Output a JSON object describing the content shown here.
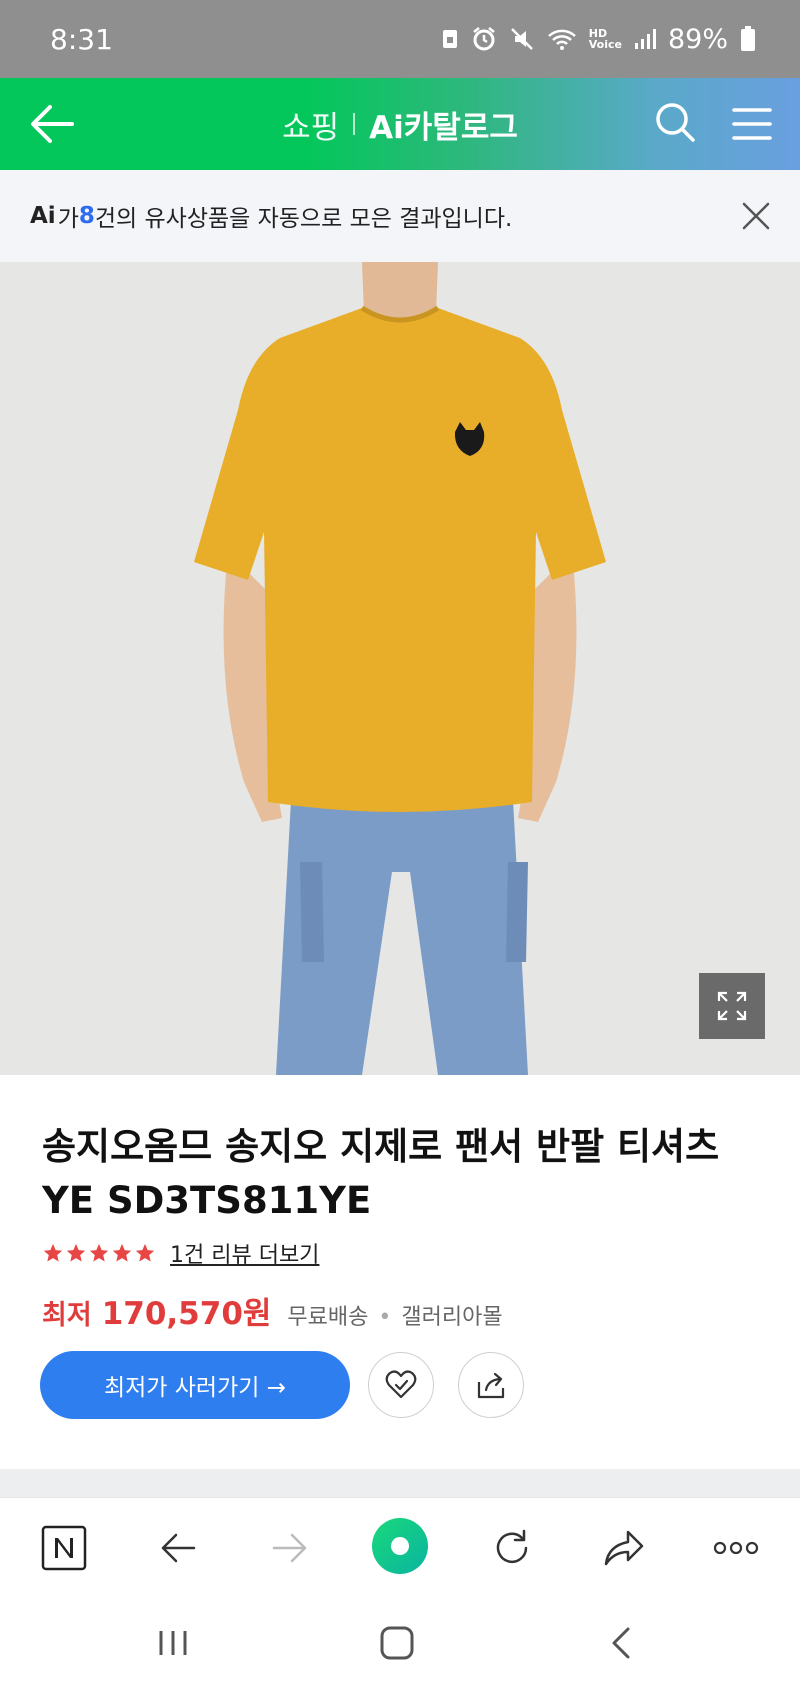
{
  "status_bar": {
    "time": "8:31",
    "hd_label": "HD",
    "voice_label": "Voice",
    "battery": "89%"
  },
  "header": {
    "shop_label": "쇼핑",
    "catalog_label": "Ai카탈로그"
  },
  "banner": {
    "ai_label": "Ai",
    "text_pre": "가 ",
    "count": "8",
    "text_post": "건의 유사상품을 자동으로 모은 결과입니다."
  },
  "product": {
    "title": "송지오옴므 송지오 지제로 팬서 반팔 티셔츠 YE SD3TS811YE",
    "rating": 5,
    "review_link": "1건 리뷰 더보기",
    "price_label": "최저",
    "price": "170,570원",
    "shipping": "무료배송",
    "separator": "•",
    "mall": "갤러리아몰",
    "buy_label": "최저가 사러가기 →"
  },
  "icons": {
    "back": "arrow-left-icon",
    "search": "search-icon",
    "menu": "hamburger-menu-icon",
    "close": "close-icon",
    "expand": "expand-icon",
    "wishlist": "heart-icon",
    "share": "share-icon"
  },
  "colors": {
    "naver_green": "#03c75a",
    "price_red": "#e03c3c",
    "button_blue": "#2f7ef0",
    "star_red": "#e84545"
  }
}
